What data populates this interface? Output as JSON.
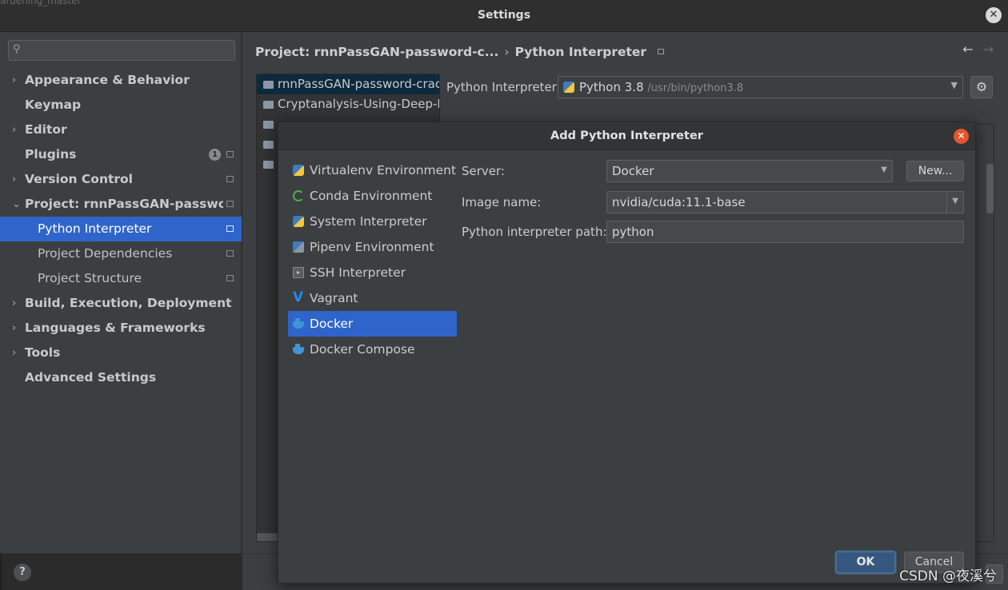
{
  "window": {
    "ghost_text": "ardening_master",
    "title": "Settings"
  },
  "search": {
    "placeholder": ""
  },
  "sidebar": {
    "items": [
      {
        "label": "Appearance & Behavior",
        "expandable": true
      },
      {
        "label": "Keymap",
        "expandable": false
      },
      {
        "label": "Editor",
        "expandable": true
      },
      {
        "label": "Plugins",
        "expandable": false,
        "badge": "1"
      },
      {
        "label": "Version Control",
        "expandable": true
      },
      {
        "label": "Project: rnnPassGAN-password-c",
        "expandable": true,
        "expanded": true
      },
      {
        "label": "Python Interpreter",
        "sub": true,
        "selected": true
      },
      {
        "label": "Project Dependencies",
        "sub": true
      },
      {
        "label": "Project Structure",
        "sub": true
      },
      {
        "label": "Build, Execution, Deployment",
        "expandable": true
      },
      {
        "label": "Languages & Frameworks",
        "expandable": true
      },
      {
        "label": "Tools",
        "expandable": true
      },
      {
        "label": "Advanced Settings",
        "expandable": false
      }
    ]
  },
  "breadcrumb": {
    "project": "Project: rnnPassGAN-password-c...",
    "separator": "›",
    "page": "Python Interpreter"
  },
  "nav": {
    "back": "←",
    "forward": "→"
  },
  "projects": [
    "rnnPassGAN-password-crack",
    "Cryptanalysis-Using-Deep-Ne",
    "",
    "",
    ""
  ],
  "interpreter": {
    "label": "Python Interpreter:",
    "value": "Python 3.8",
    "path": "/usr/bin/python3.8"
  },
  "dialog": {
    "title": "Add Python Interpreter",
    "types": [
      {
        "label": "Virtualenv Environment",
        "icon": "virtualenv-icon"
      },
      {
        "label": "Conda Environment",
        "icon": "conda-icon"
      },
      {
        "label": "System Interpreter",
        "icon": "system-python-icon"
      },
      {
        "label": "Pipenv Environment",
        "icon": "pipenv-icon"
      },
      {
        "label": "SSH Interpreter",
        "icon": "ssh-icon"
      },
      {
        "label": "Vagrant",
        "icon": "vagrant-icon"
      },
      {
        "label": "Docker",
        "icon": "docker-icon",
        "selected": true
      },
      {
        "label": "Docker Compose",
        "icon": "docker-compose-icon"
      }
    ],
    "server_label": "Server:",
    "server_value": "Docker",
    "new_button": "New...",
    "image_label": "Image name:",
    "image_value": "nvidia/cuda:11.1-base",
    "path_label": "Python interpreter path:",
    "path_value": "python",
    "ok": "OK",
    "cancel": "Cancel"
  },
  "watermark": "CSDN @夜溪兮",
  "colors": {
    "selection": "#2f65ca",
    "panel": "#3c3f41",
    "close_button": "#e4562d"
  }
}
